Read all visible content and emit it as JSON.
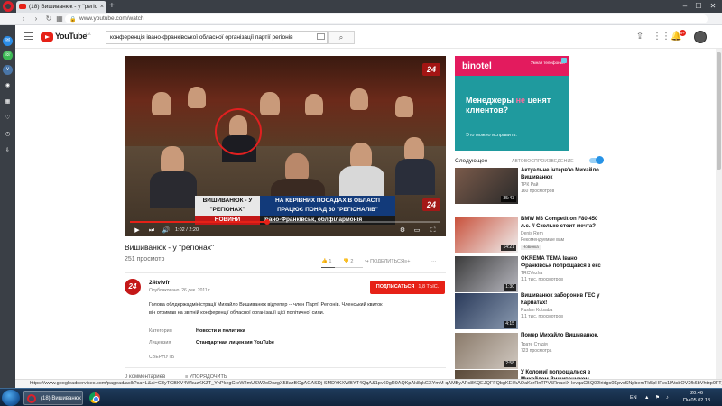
{
  "browser": {
    "tab_title": "(18) Вишиванюк - у \"регіо",
    "url": "www.youtube.com/watch",
    "window_controls": [
      "–",
      "☐",
      "✕"
    ]
  },
  "youtube": {
    "logo_text": "YouTube",
    "logo_region": "UA",
    "search_query": "конференція івано-франківської обласної організації партії регіонів",
    "notifications_count": "9+"
  },
  "player": {
    "caption_left_line1": "ВИШИВАНЮК - У",
    "caption_left_line2": "\"РЕГІОНАХ\"",
    "caption_right_line1": "НА КЕРІВНИХ ПОСАДАХ В ОБЛАСТІ",
    "caption_right_line2": "ПРАЦЮЄ ПОНАД 60 \"РЕГІОНАЛІВ\"",
    "news_label": "НОВИНИ",
    "location": "Івано-Франківськ, облфілармонія",
    "channel_logo": "24",
    "time_current": "1:02",
    "time_total": "2:20",
    "progress_fraction": 0.443
  },
  "video": {
    "title": "Вишиванюк - у \"регіонах\"",
    "views": "251 просмотр",
    "likes": "1",
    "dislikes": "2",
    "share_label": "ПОДЕЛИТЬСЯ",
    "like_fraction": 0.33
  },
  "channel": {
    "name": "24tvivfr",
    "avatar_text": "24",
    "published": "Опубликовано: 26 дек. 2011 г.",
    "subscribe_label": "ПОДПИСАТЬСЯ",
    "subscribers": "1,8 ТЫС."
  },
  "description": {
    "text": "Голова облдержадміністрації Михайло Вишиванюк відтепер -- член Партії Регіонів. Членський квиток він отримав на звітній конференції обласної організації цієї політичної сили.",
    "category_label": "Категория",
    "category_value": "Новости и политика",
    "license_label": "Лицензия",
    "license_value": "Стандартная лицензия YouTube",
    "collapse_label": "СВЕРНУТЬ"
  },
  "comments": {
    "count_label": "0 комментариев",
    "sort_label": "УПОРЯДОЧИТЬ"
  },
  "ad": {
    "brand": "binotel",
    "tagline": "Умная телефония",
    "headline_pre": "Менеджеры ",
    "headline_ne": "не",
    "headline_post": " ценят клиентов?",
    "sub": "Это можно исправить.",
    "colors": {
      "bg": "#1f9a9e",
      "strip": "#e31b5e"
    }
  },
  "upnext": {
    "label": "Следующее",
    "autoplay_label": "АВТОВОСПРОИЗВЕДЕНИЕ",
    "autoplay_on": true
  },
  "recommendations": [
    {
      "title": "Актуальне інтерв'ю Михайло Вишиванюк",
      "channel": "ТРК Рай",
      "views": "160 просмотров",
      "duration": "35:43",
      "badge": "",
      "palette": [
        "#7a5a4a",
        "#2a2a2a"
      ]
    },
    {
      "title": "BMW M3 Competition F80 450 л.с. // Сколько стоит мечта?",
      "channel": "Denis Rem",
      "views": "Рекомендуемые вам",
      "duration": "14:21",
      "badge": "Новинка",
      "palette": [
        "#c8503a",
        "#f0f0f0"
      ]
    },
    {
      "title": "OKREMA TEMA Івано Франківськ попрощався з екс",
      "channel": "TRCVezha",
      "views": "1,1 тыс. просмотров",
      "duration": "1:30",
      "badge": "",
      "palette": [
        "#3a3a3a",
        "#b8b8c0"
      ]
    },
    {
      "title": "Вишиванюк заборонив ГЕС у Карпатах!",
      "channel": "Ruslan Kotsaba",
      "views": "1,1 тыс. просмотров",
      "duration": "4:15",
      "badge": "",
      "palette": [
        "#2a3a5a",
        "#8a9ab0"
      ]
    },
    {
      "title": "Помер Михайло Вишиванюк.",
      "channel": "Трате Студія",
      "views": "723 просмотра",
      "duration": "2:58",
      "badge": "",
      "palette": [
        "#8a7a6a",
        "#d0c8c0"
      ]
    },
    {
      "title": "У Коломиї попрощалися з Михайлом Вишиванюком",
      "channel": "",
      "views": "",
      "duration": "",
      "badge": "",
      "palette": [
        "#5a4a3a",
        "#9a8a7a"
      ]
    }
  ],
  "statusbar": {
    "text": "https://www.googleadservices.com/pagead/aclk?sa=L&ai=C3yTGBKV4WkuzKKZT_YnPkegCreW2mUSW2oDozgX58azBGgAGASDj-SMDYKXWBYT4QqA&1pv60gR9AQKpAk8qkGXYmM-qAMByAPc8KQEJQFFQbgKEIfkAOaKcrRnTPV5RnaeiX-levqaCBQ02lridgc0EpvcSNpbemTk5pHFvs1lAtsbOV2fk6bVhtzp0FT_NtkQNtMPn5CoqDVWHL"
  },
  "taskbar": {
    "opera_label": "(18) Вишиванюк -...",
    "lang": "EN",
    "time": "20:46",
    "date": "Пн 05.02.18"
  }
}
